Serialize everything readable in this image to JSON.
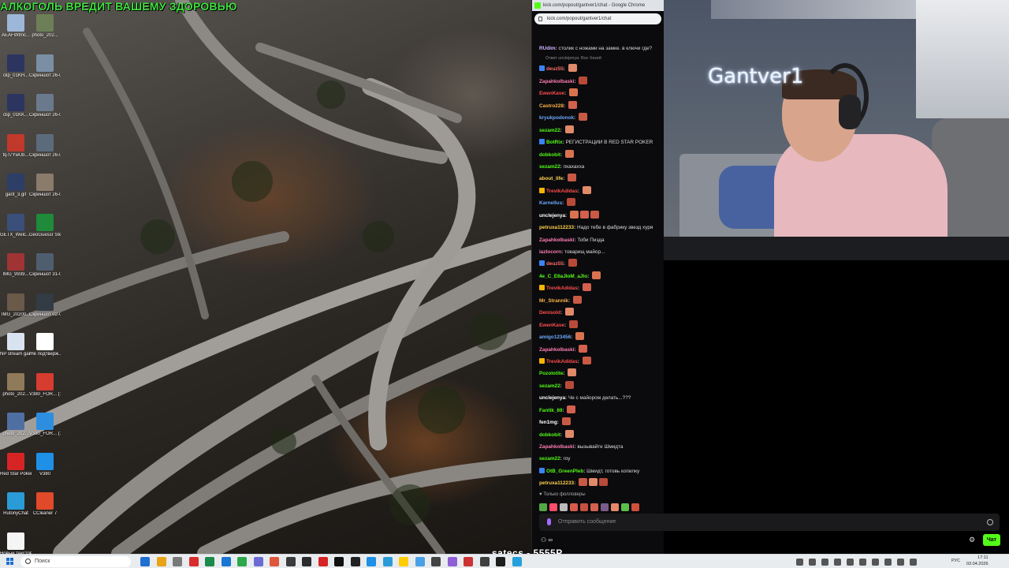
{
  "overlay": {
    "banner": "АЛКОГОЛЬ ВРЕДИТ ВАШЕМУ ЗДОРОВЬЮ"
  },
  "desktop_icons": [
    {
      "label": "AEAFWtmc...",
      "color": "#9db7d8"
    },
    {
      "label": "photo_202...",
      "color": "#6c7f57"
    },
    {
      "label": "clip_01KH...",
      "color": "#2b3560"
    },
    {
      "label": "Скриншот 26-03-20...",
      "color": "#7a8fa4"
    },
    {
      "label": "clip_01KK...",
      "color": "#2b3560"
    },
    {
      "label": "Скриншот 26-03-20...",
      "color": "#6a7a8c"
    },
    {
      "label": "fq-f7YwUb...",
      "color": "#c0392b"
    },
    {
      "label": "Скриншот 26-03-20...",
      "color": "#5b6b7c"
    },
    {
      "label": "gant_3.gif",
      "color": "#2d3e66"
    },
    {
      "label": "Скриншот 26-03-20...",
      "color": "#8a7b6b"
    },
    {
      "label": "GETX_Welc... 2_gantver...",
      "color": "#3a4f7a"
    },
    {
      "label": "GeoGuessr Steam E...",
      "color": "#1f8a3a"
    },
    {
      "label": "IMG_9939...",
      "color": "#a03434"
    },
    {
      "label": "Скриншот 31-03-20...",
      "color": "#4f5e6f"
    },
    {
      "label": "IMG_20200...",
      "color": "#6a5a4a"
    },
    {
      "label": "Скриншот 02-04-20...",
      "color": "#333b44"
    },
    {
      "label": "NP stream gantver1...",
      "color": "#d9e3ef"
    },
    {
      "label": "iHe подтверж...",
      "color": "#ffffff"
    },
    {
      "label": "photo_202...",
      "color": "#8f7a5a"
    },
    {
      "label": "V380_FOR... (1).zip",
      "color": "#d63c2f"
    },
    {
      "label": "photo_202...",
      "color": "#4f6fa3"
    },
    {
      "label": "V380_FOR... (1)",
      "color": "#2d8ee0"
    },
    {
      "label": "Red Star Poker",
      "color": "#d62424"
    },
    {
      "label": "V380",
      "color": "#1e90e6"
    },
    {
      "label": "RutonyChat",
      "color": "#2a9bd7"
    },
    {
      "label": "CCleaner 7",
      "color": "#e04a2a"
    },
    {
      "label": "Новый текстовый ...",
      "color": "#f5f5f5"
    }
  ],
  "browser": {
    "title": "kick.com/popout/gantver1/chat - Google Chrome",
    "url": "kick.com/popout/gantver1/chat"
  },
  "chat": {
    "messages": [
      {
        "user": "RUdim",
        "color": "#d0b3ff",
        "text": "столик с ножами на замке. в ключи где?",
        "emotes": 0,
        "badge": ""
      },
      {
        "reply": "Ответ unclejenya: Все Хекей"
      },
      {
        "user": "deuz55",
        "color": "#ff6b6b",
        "text": "",
        "emotes": 1,
        "badge": "#3b82f6"
      },
      {
        "user": "Zapahkolbaski",
        "color": "#ff7eb6",
        "text": "",
        "emotes": 1,
        "badge": ""
      },
      {
        "user": "EwenKave",
        "color": "#ff4d4d",
        "text": "",
        "emotes": 1,
        "badge": ""
      },
      {
        "user": "Castro228",
        "color": "#ffb347",
        "text": "",
        "emotes": 1,
        "badge": ""
      },
      {
        "user": "kryukpodonok",
        "color": "#6ea8ff",
        "text": "",
        "emotes": 1,
        "badge": ""
      },
      {
        "user": "sezam22",
        "color": "#53fc18",
        "text": "",
        "emotes": 1,
        "badge": ""
      },
      {
        "user": "BotRix",
        "color": "#53fc18",
        "text": "РЕГИСТРАЦИИ В RED STAR POKER",
        "emotes": 0,
        "badge": "#3b82f6"
      },
      {
        "user": "dobkobit",
        "color": "#53fc18",
        "text": "",
        "emotes": 1,
        "badge": ""
      },
      {
        "user": "sezam22",
        "color": "#53fc18",
        "text": "пхахахха",
        "emotes": 0,
        "badge": ""
      },
      {
        "user": "about_life",
        "color": "#ffd24d",
        "text": "",
        "emotes": 1,
        "badge": ""
      },
      {
        "user": "TrevikAdidas",
        "color": "#ff4d4d",
        "text": "",
        "emotes": 1,
        "badge": "#f5b400"
      },
      {
        "user": "Karnellus",
        "color": "#6ea8ff",
        "text": "",
        "emotes": 1,
        "badge": ""
      },
      {
        "user": "unclejenya",
        "color": "#ffffff",
        "text": "",
        "emotes": 3,
        "badge": ""
      },
      {
        "user": "petruxa112233",
        "color": "#ffd24d",
        "text": "Надо тебе в фабрику звезд хуря",
        "emotes": 0,
        "badge": ""
      },
      {
        "user": "Zapahkolbaski",
        "color": "#ff7eb6",
        "text": "Тоби Пизда",
        "emotes": 0,
        "badge": ""
      },
      {
        "user": "iazlocorn",
        "color": "#ff7eb6",
        "text": "товарищ майор...",
        "emotes": 0,
        "badge": ""
      },
      {
        "user": "deuz55",
        "color": "#ff6b6b",
        "text": "",
        "emotes": 1,
        "badge": "#3b82f6"
      },
      {
        "user": "4e_C_E6aJIoM_aJIo",
        "color": "#53fc18",
        "text": "",
        "emotes": 1,
        "badge": ""
      },
      {
        "user": "TrevikAdidas",
        "color": "#ff4d4d",
        "text": "",
        "emotes": 1,
        "badge": "#f5b400"
      },
      {
        "user": "Mr_Strannik",
        "color": "#ffb347",
        "text": "",
        "emotes": 1,
        "badge": ""
      },
      {
        "user": "Denisold",
        "color": "#ff4d4d",
        "text": "",
        "emotes": 1,
        "badge": ""
      },
      {
        "user": "EwenKave",
        "color": "#ff4d4d",
        "text": "",
        "emotes": 1,
        "badge": ""
      },
      {
        "user": "amigo123456",
        "color": "#6ea8ff",
        "text": "",
        "emotes": 1,
        "badge": ""
      },
      {
        "user": "Zapahkolbaski",
        "color": "#ff7eb6",
        "text": "",
        "emotes": 1,
        "badge": ""
      },
      {
        "user": "TrevikAdidas",
        "color": "#ff4d4d",
        "text": "",
        "emotes": 1,
        "badge": "#f5b400"
      },
      {
        "user": "Pozolotite",
        "color": "#53fc18",
        "text": "",
        "emotes": 1,
        "badge": ""
      },
      {
        "user": "sezam22",
        "color": "#53fc18",
        "text": "",
        "emotes": 1,
        "badge": ""
      },
      {
        "user": "unclejenya",
        "color": "#ffffff",
        "text": "Че с майором делать...???",
        "emotes": 0,
        "badge": ""
      },
      {
        "user": "Fantik_69",
        "color": "#53fc18",
        "text": "",
        "emotes": 1,
        "badge": ""
      },
      {
        "user": "fen1mg",
        "color": "#ffffff",
        "text": "",
        "emotes": 1,
        "badge": ""
      },
      {
        "user": "dobkobit",
        "color": "#53fc18",
        "text": "",
        "emotes": 1,
        "badge": ""
      },
      {
        "user": "Zapahkolbaski",
        "color": "#ff7eb6",
        "text": "вызывайте Шмидта",
        "emotes": 0,
        "badge": ""
      },
      {
        "user": "sezam22",
        "color": "#53fc18",
        "text": "гоу",
        "emotes": 0,
        "badge": ""
      },
      {
        "user": "OtB_GreenPleb",
        "color": "#53fc18",
        "text": "Шмидт, готовь копилку",
        "emotes": 0,
        "badge": "#3b82f6"
      },
      {
        "user": "petruxa112233",
        "color": "#ffd24d",
        "text": "",
        "emotes": 3,
        "badge": ""
      }
    ],
    "followers_only": "Только фолловеры",
    "input_placeholder": "Отправить сообщение",
    "points": "∞",
    "send_label": "Чат"
  },
  "webcam": {
    "name_sign": "Gantver1"
  },
  "donation": {
    "text": "satecs - 5555Р"
  },
  "taskbar": {
    "search_placeholder": "Поиск",
    "lang": "РУС",
    "time": "17:11",
    "date": "03.04.2026",
    "apps": [
      "#1f6fd1",
      "#e8a317",
      "#7a7a7a",
      "#d92c2c",
      "#1b8a4a",
      "#1976d2",
      "#2aa84a",
      "#6b6bd6",
      "#e0563b",
      "#3b3b3b",
      "#2b2b2b",
      "#d62424",
      "#111111",
      "#222222",
      "#1e90e6",
      "#2a9bd7",
      "#ffcc00",
      "#4aa0e6",
      "#444444",
      "#8f5fd6",
      "#cc3333",
      "#3f3f3f",
      "#1c1c1c",
      "#25a0da"
    ]
  }
}
